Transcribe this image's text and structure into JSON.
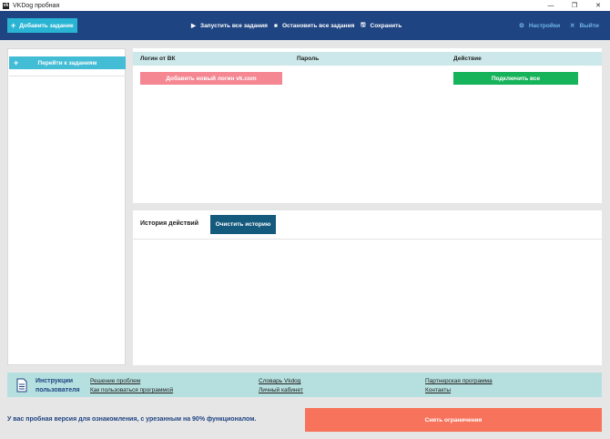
{
  "window": {
    "title": "VKDog пробная",
    "logo_text": "vk",
    "controls": {
      "minimize": "—",
      "restore": "❐",
      "close": "✕"
    }
  },
  "toolbar": {
    "add_task": "Добавить задание",
    "start_all": "Запустить все задания",
    "stop_all": "Остановить все задания",
    "save": "Сохранить",
    "settings": "Настройки",
    "logout": "Выйти"
  },
  "sidebar": {
    "goto_tasks": "Перейти к заданиям"
  },
  "logins_table": {
    "columns": [
      "Логин от ВК",
      "Пароль",
      "Действие"
    ],
    "add_login": "Добавить новый логин vk.com",
    "connect_all": "Подключить все"
  },
  "history": {
    "title": "История действий",
    "clear": "Очистить историю"
  },
  "footer": {
    "help_title_line1": "Инструкции",
    "help_title_line2": "пользователя",
    "links": [
      "Решение проблем",
      "Как пользоваться программой",
      "Словарь Vkdog",
      "Личный кабинет",
      "Партнерская программа",
      "Контакты"
    ]
  },
  "trial": {
    "notice": "У вас пробная версия для ознакомления, с урезанным на 90% функционалом.",
    "remove_limits": "Снять ограничения"
  },
  "colors": {
    "toolbar_bg": "#1f4482",
    "accent_cyan": "#29b4d3",
    "add_login_pink": "#f58793",
    "connect_green": "#16b35b",
    "clear_dark_teal": "#145a7c",
    "remove_limits_orange": "#f7735c"
  }
}
